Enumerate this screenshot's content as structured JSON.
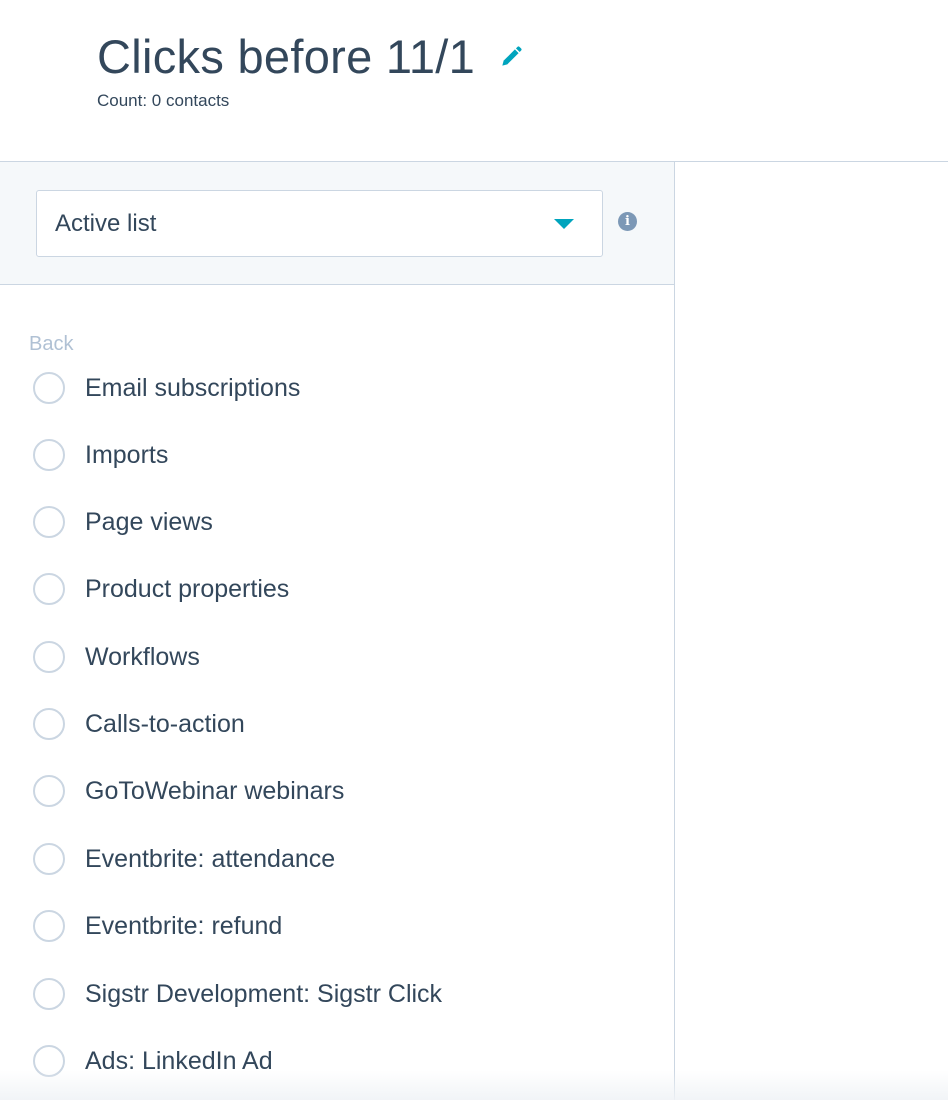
{
  "header": {
    "title": "Clicks before 11/1",
    "count": "Count: 0 contacts"
  },
  "filter": {
    "selected_type": "Active list"
  },
  "back_label": "Back",
  "options": [
    {
      "label": "Email subscriptions"
    },
    {
      "label": "Imports"
    },
    {
      "label": "Page views"
    },
    {
      "label": "Product properties"
    },
    {
      "label": "Workflows"
    },
    {
      "label": "Calls-to-action"
    },
    {
      "label": "GoToWebinar webinars"
    },
    {
      "label": "Eventbrite: attendance"
    },
    {
      "label": "Eventbrite: refund"
    },
    {
      "label": "Sigstr Development: Sigstr Click"
    },
    {
      "label": "Ads: LinkedIn Ad"
    }
  ],
  "colors": {
    "text": "#33475b",
    "accent": "#00a4bd",
    "border": "#cbd6e2",
    "muted": "#b0c1d4"
  }
}
